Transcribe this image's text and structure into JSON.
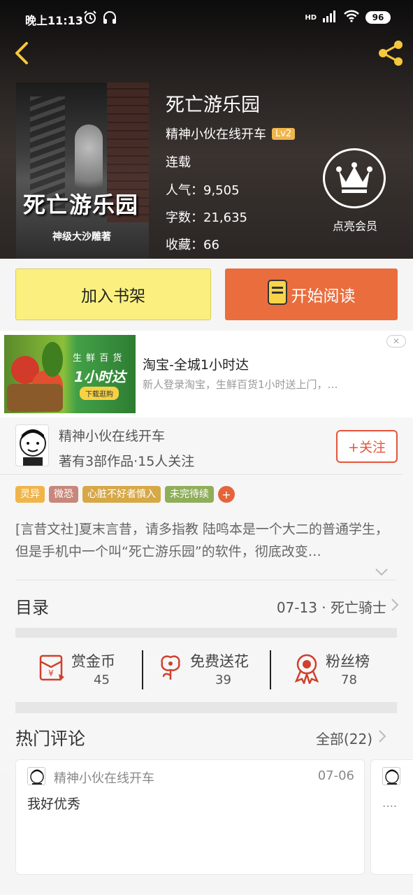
{
  "status_bar": {
    "time": "晚上11:13",
    "network": "HD",
    "battery": "96"
  },
  "book": {
    "title": "死亡游乐园",
    "author": "精神小伙在线开车",
    "level": "Lv2",
    "status": "连载",
    "popularity_label": "人气：",
    "popularity": "9,505",
    "words_label": "字数：",
    "words": "21,635",
    "favorites_label": "收藏：",
    "favorites": "66",
    "cover_title": "死亡游乐园",
    "cover_author": "神级大沙雕著"
  },
  "vip": {
    "label": "点亮会员"
  },
  "actions": {
    "shelf": "加入书架",
    "read": "开始阅读"
  },
  "ad": {
    "tagline": "生 鲜 百 货",
    "big": "1小时达",
    "download": "下载逛购",
    "title": "淘宝-全城1小时达",
    "desc": "新人登录淘宝，生鲜百货1小时送上门，…"
  },
  "author_info": {
    "name": "精神小伙在线开车",
    "stats": "著有3部作品·15人关注",
    "follow": "+关注"
  },
  "tags": [
    {
      "label": "灵异",
      "color": "#f0b54a"
    },
    {
      "label": "微恐",
      "color": "#c7877a"
    },
    {
      "label": "心脏不好者慎入",
      "color": "#d7a846"
    },
    {
      "label": "未完待续",
      "color": "#8fae5a"
    }
  ],
  "tag_more": "+",
  "description": "[言昔文社]夏末言昔，请多指教 陆鸣本是一个大二的普通学生，但是手机中一个叫“死亡游乐园”的软件，彻底改变…",
  "toc": {
    "label": "目录",
    "latest": "07-13 · 死亡骑士"
  },
  "stats": {
    "reward": {
      "label": "赏金币",
      "value": "45"
    },
    "flower": {
      "label": "免费送花",
      "value": "39"
    },
    "fans": {
      "label": "粉丝榜",
      "value": "78"
    }
  },
  "hot": {
    "label": "热门评论",
    "all": "全部(22)"
  },
  "comments": [
    {
      "name": "精神小伙在线开车",
      "date": "07-06",
      "text": "我好优秀"
    },
    {
      "text": "…."
    }
  ],
  "colors": {
    "accent": "#ea6d3d",
    "shelf": "#fbf07f",
    "follow": "#e5543a",
    "icon_red": "#d0402c"
  }
}
